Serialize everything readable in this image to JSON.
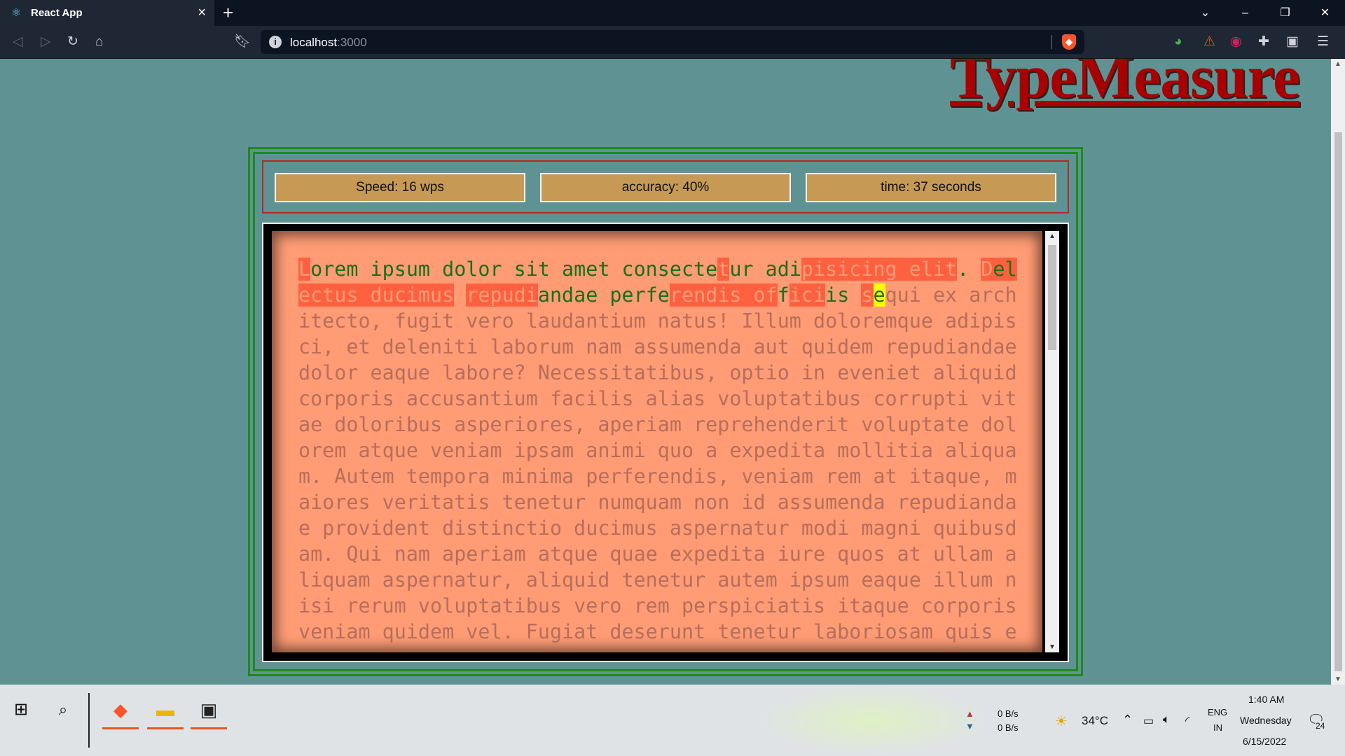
{
  "browser": {
    "tab_title": "React App",
    "new_tab": "+",
    "url_host": "localhost",
    "url_port": ":3000"
  },
  "app": {
    "logo": "TypeMeasure",
    "stats": {
      "speed": "Speed: 16 wps",
      "accuracy": "accuracy: 40%",
      "time": "time: 37 seconds"
    },
    "text_segments": [
      {
        "t": "L",
        "s": "bad"
      },
      {
        "t": "orem ipsum dolor sit amet consecte",
        "s": "ok"
      },
      {
        "t": "t",
        "s": "bad"
      },
      {
        "t": "ur adi",
        "s": "ok"
      },
      {
        "t": "pisicing elit",
        "s": "bad"
      },
      {
        "t": ". ",
        "s": "ok"
      },
      {
        "t": "D",
        "s": "bad"
      },
      {
        "t": "el",
        "s": "okbad"
      },
      {
        "t": "ectus ducimus",
        "s": "bad"
      },
      {
        "t": " ",
        "s": "ok"
      },
      {
        "t": "repudi",
        "s": "bad"
      },
      {
        "t": "andae perfe",
        "s": "ok"
      },
      {
        "t": "rendis of",
        "s": "bad"
      },
      {
        "t": "f",
        "s": "ok"
      },
      {
        "t": "ici",
        "s": "bad"
      },
      {
        "t": "is ",
        "s": "ok"
      },
      {
        "t": "s",
        "s": "bad"
      },
      {
        "t": "e",
        "s": "cur"
      },
      {
        "t": "qui ex architecto, fugit vero laudantium natus! Illum doloremque adipisci, et deleniti laborum nam assumenda aut quidem repudiandae dolor eaque labore? Necessitatibus, optio in eveniet aliquid corporis accusantium facilis alias voluptatibus corrupti vitae doloribus asperiores, aperiam reprehenderit voluptate dolorem atque veniam ipsam animi quo a expedita mollitia aliquam. Autem tempora minima perferendis, veniam rem at itaque, maiores veritatis tenetur numquam non id assumenda repudiandae provident distinctio ducimus aspernatur modi magni quibusdam. Qui nam aperiam atque quae expedita iure quos at ullam aliquam aspernatur, aliquid tenetur autem ipsum eaque illum nisi rerum voluptatibus vero rem perspiciatis itaque corporis veniam quidem vel. Fugiat deserunt tenetur laboriosam quis e",
        "s": "rest"
      }
    ]
  },
  "taskbar": {
    "net_up": "0 B/s",
    "net_down": "0 B/s",
    "weather": "34°C",
    "lang1": "ENG",
    "lang2": "IN",
    "time": "1:40 AM",
    "day": "Wednesday",
    "date": "6/15/2022",
    "notif_count": "24"
  },
  "colors": {
    "page_bg": "#5f9393",
    "text_bg": "#ff9c75",
    "correct": "#187018",
    "wrong_bg": "#ff6040",
    "cursor": "#ffff00",
    "stat_bg": "#c69a55"
  }
}
